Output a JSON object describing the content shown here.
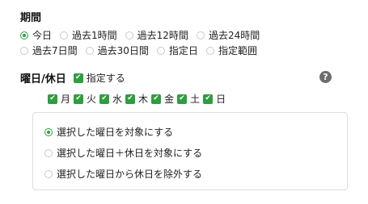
{
  "period": {
    "title": "期間",
    "options": [
      {
        "label": "今日",
        "checked": true
      },
      {
        "label": "過去1時間",
        "checked": false
      },
      {
        "label": "過去12時間",
        "checked": false
      },
      {
        "label": "過去24時間",
        "checked": false
      },
      {
        "label": "過去7日間",
        "checked": false
      },
      {
        "label": "過去30日間",
        "checked": false
      },
      {
        "label": "指定日",
        "checked": false
      },
      {
        "label": "指定範囲",
        "checked": false
      }
    ]
  },
  "weekday": {
    "title": "曜日/休日",
    "specify_label": "指定する",
    "specify_checked": true,
    "help_icon": "?",
    "days": [
      "月",
      "火",
      "水",
      "木",
      "金",
      "土",
      "日"
    ],
    "modes": [
      {
        "label": "選択した曜日を対象にする",
        "checked": true
      },
      {
        "label": "選択した曜日＋休日を対象にする",
        "checked": false
      },
      {
        "label": "選択した曜日から休日を除外する",
        "checked": false
      }
    ]
  },
  "colors": {
    "accent": "#2e9e3e",
    "border": "#dedede",
    "help": "#6d6d6d"
  }
}
